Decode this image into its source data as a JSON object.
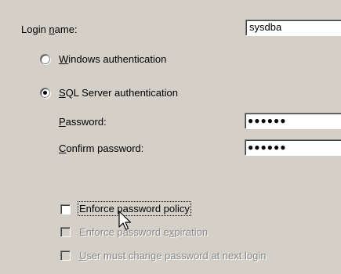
{
  "login": {
    "label": "Login name:",
    "label_mnemonic": "n",
    "value": "sysdba"
  },
  "auth": {
    "windows": {
      "mnemonic": "W",
      "rest": "indows authentication",
      "selected": false
    },
    "sql": {
      "mnemonic": "S",
      "rest": "QL Server authentication",
      "selected": true
    }
  },
  "password": {
    "label_mnemonic": "P",
    "label_rest": "assword:",
    "value": "●●●●●●"
  },
  "confirm": {
    "label_mnemonic": "C",
    "label_rest": "onfirm password:",
    "value": "●●●●●●"
  },
  "options": {
    "enforce_policy": {
      "label": "Enforce password policy",
      "checked": false,
      "enabled": true
    },
    "enforce_expiration": {
      "label_pre": "Enforce password e",
      "mnemonic": "x",
      "label_post": "piration",
      "checked": false,
      "enabled": false
    },
    "must_change": {
      "mnemonic": "U",
      "label_rest": "ser must change password at next login",
      "checked": false,
      "enabled": false
    }
  },
  "colors": {
    "dialog_bg": "#d4d0c8",
    "disabled_text": "#8a8a8a"
  },
  "icons": {
    "cursor": "mouse-pointer-icon"
  }
}
